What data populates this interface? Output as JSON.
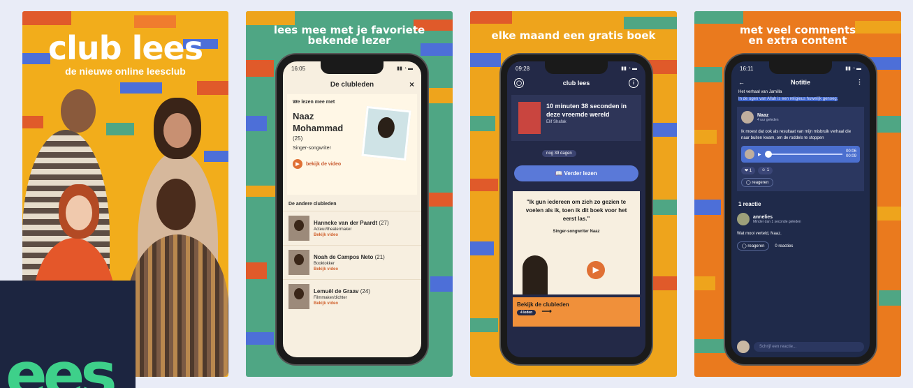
{
  "panel1": {
    "title": "club lees",
    "subtitle": "de nieuwe online leesclub"
  },
  "panel2": {
    "headline_line1": "lees mee met je favoriete",
    "headline_line2": "bekende lezer",
    "status_time": "16:05",
    "dialog_title": "De clubleden",
    "close_icon": "×",
    "reading_with": "We lezen mee met",
    "featured_name_line1": "Naaz",
    "featured_name_line2": "Mohammad",
    "featured_age": "(25)",
    "featured_role": "Singer-songwriter",
    "watch_label": "bekijk de video",
    "others_title": "De andere clubleden",
    "members": [
      {
        "name": "Hanneke van der Paardt",
        "age": "(27)",
        "role": "Acteur/theatermaker",
        "link": "Bekijk video"
      },
      {
        "name": "Noah de Campos Neto",
        "age": "(21)",
        "role": "Booktokker",
        "link": "Bekijk video"
      },
      {
        "name": "Lemuël de Graav",
        "age": "(24)",
        "role": "Filmmaker/dichter",
        "link": "Bekijk video"
      }
    ]
  },
  "panel3": {
    "headline": "elke maand een gratis boek",
    "status_time": "09:28",
    "app_title": "club lees",
    "book_title": "10 minuten 38 seconden in deze vreemde wereld",
    "book_author": "Elif Shafak",
    "days_left": "nog 39 dagen",
    "read_button": "Verder lezen",
    "quote": "\"Ik gun iedereen om zich zo gezien te voelen als ik, toen ik dit boek voor het eerst las.\"",
    "quote_signature": "Singer-songwriter Naaz",
    "club_bar_label": "Bekijk de clubleden",
    "club_count": "4 leden"
  },
  "panel4": {
    "headline_line1": "met veel comments",
    "headline_line2": "en extra content",
    "status_time": "16:11",
    "screen_title": "Notitie",
    "story_title": "Het verhaal van Jamilla",
    "highlight": "In de ogen van Allah is een religieus huwelijk genoeg.",
    "comment_author": "Naaz",
    "comment_time": "4 uur geleden",
    "comment_text": "Ik moest dat ook als resultaat van mijn misbruik verhaal die naar buiten kwam, om de roddels te stoppen",
    "audio_time": "00:06",
    "audio_total": "00:09",
    "react_count_heart": "1",
    "react_count_other": "1",
    "reply_label": "reageren",
    "reaction_count": "1 reactie",
    "reply_author": "annelies",
    "reply_time": "Minder dan 1 seconde geleden",
    "reply_text": "Wat mooi verteld, Naaz.",
    "reply_reactions": "0 reacties",
    "input_placeholder": "Schrijf een reactie..."
  },
  "logo": {
    "text": "ees"
  }
}
